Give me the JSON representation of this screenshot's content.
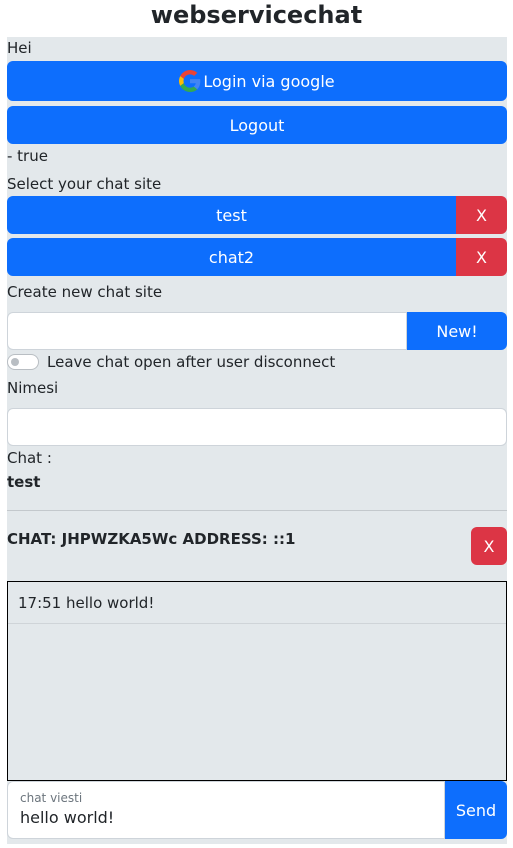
{
  "app_title": "webservicechat",
  "greeting": "Hei",
  "login_label": "Login via google",
  "logout_label": "Logout",
  "status_text": "- true",
  "select_site_label": "Select your chat site",
  "sites": [
    {
      "name": "test",
      "delete_label": "X"
    },
    {
      "name": "chat2",
      "delete_label": "X"
    }
  ],
  "create_site_label": "Create new chat site",
  "new_site_input": {
    "value": "",
    "placeholder": ""
  },
  "new_button_label": "New!",
  "toggle_label": "Leave chat open after user disconnect",
  "toggle_on": false,
  "name_label": "Nimesi",
  "name_input": {
    "value": ""
  },
  "chat_label": "Chat :",
  "current_chat": "test",
  "chat_header": "CHAT: JHPWZKA5Wc ADDRESS: ::1",
  "chat_close_label": "X",
  "messages": [
    {
      "text": "17:51 hello world!"
    }
  ],
  "message_input": {
    "label": "chat viesti",
    "value": "hello world!"
  },
  "send_label": "Send",
  "icons": {
    "google": "google-g-icon"
  },
  "colors": {
    "primary": "#0d6efd",
    "danger": "#dc3545",
    "panel": "#e3e8eb"
  }
}
